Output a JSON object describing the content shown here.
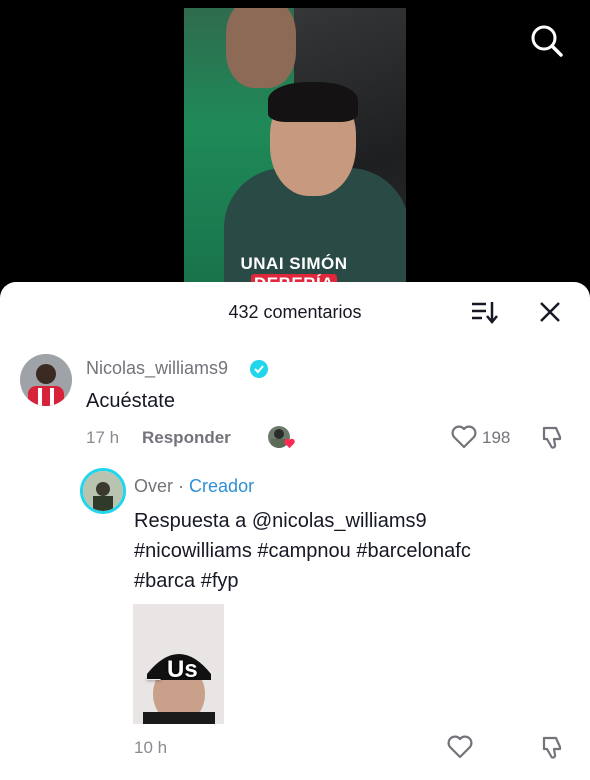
{
  "video": {
    "caption_prefix": "UNAI SIMÓN",
    "caption_highlight": "DEBERÍA"
  },
  "comments_header": {
    "count_label": "432 comentarios"
  },
  "comment": {
    "username": "Nicolas_williams9",
    "text": "Acuéstate",
    "time": "17 h",
    "reply_label": "Responder",
    "likes": "198"
  },
  "reply": {
    "username": "Over",
    "separator": "·",
    "creator_label": "Creador",
    "line1": "Respuesta a @nicolas_williams9",
    "line2": "#nicowilliams #campnou #barcelonafc",
    "line3": "#barca #fyp",
    "thumb_overlay": "_ Us",
    "time": "10 h"
  },
  "colors": {
    "accent": "#2f8fd6",
    "verified": "#20d5ec",
    "text": "#161823",
    "muted": "#73747b"
  }
}
